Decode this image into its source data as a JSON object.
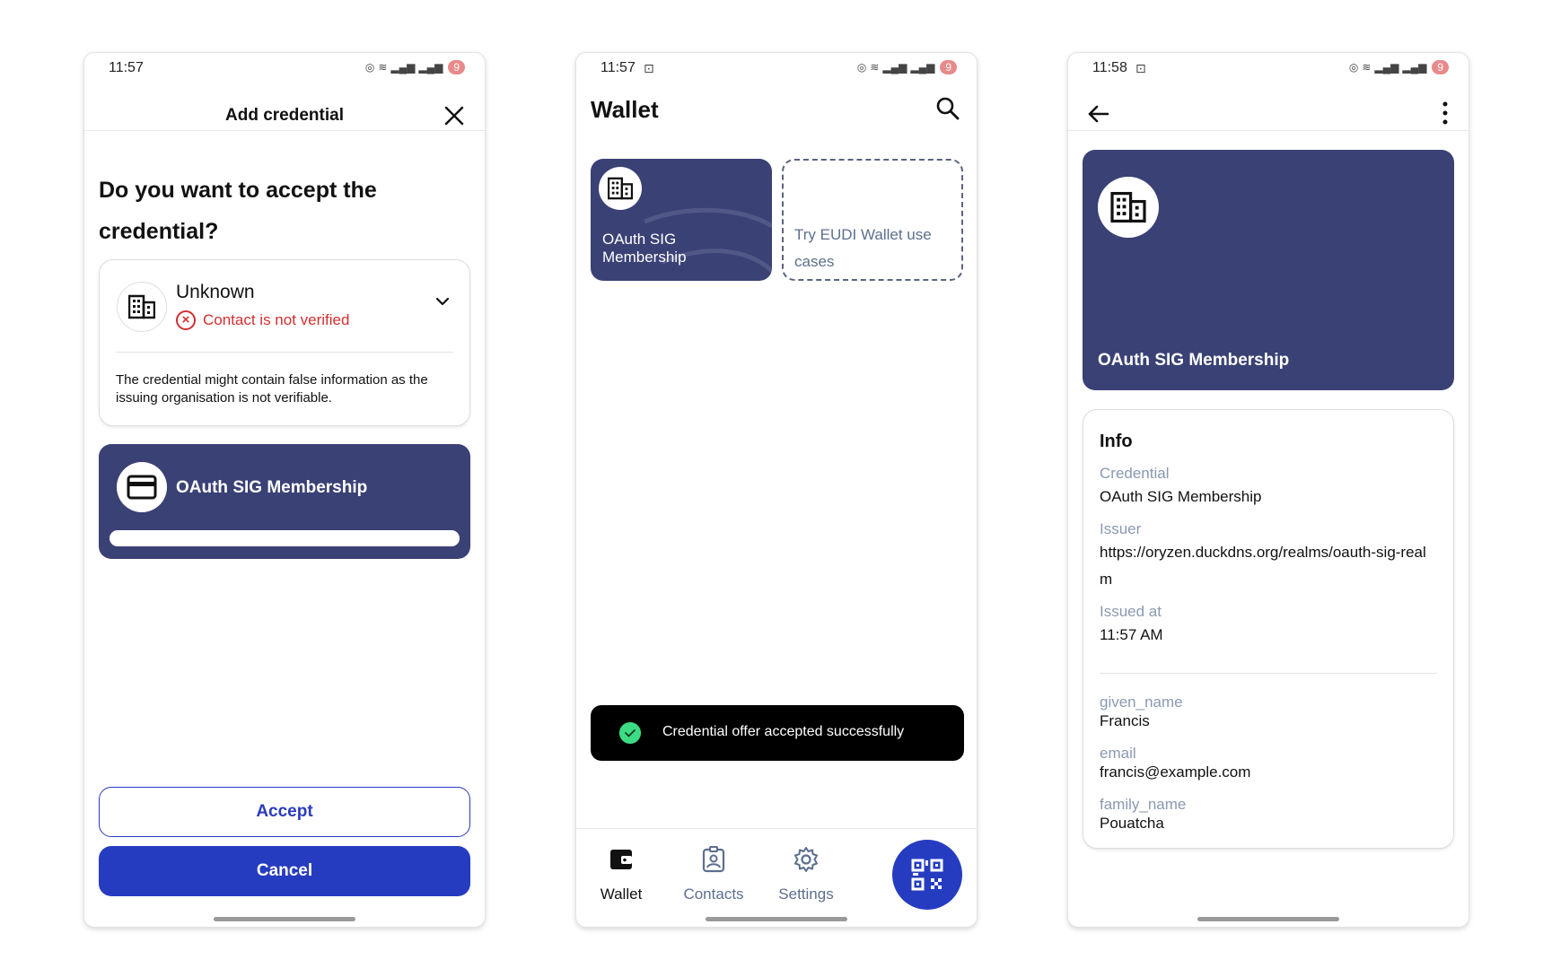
{
  "colors": {
    "card_navy": "#3a4175",
    "primary_blue": "#263cc0",
    "error_red": "#d32f2f",
    "muted_text": "#5c6f8f",
    "success_green": "#3ddc84"
  },
  "screen1": {
    "status": {
      "time": "11:57",
      "battery": "9"
    },
    "title": "Add credential",
    "question": "Do you want to accept the credential?",
    "issuer": {
      "name": "Unknown",
      "warning": "Contact is not verified",
      "description": "The credential might contain false information as the issuing organisation is not verifiable."
    },
    "credential": {
      "title": "OAuth SIG Membership"
    },
    "buttons": {
      "accept": "Accept",
      "cancel": "Cancel"
    }
  },
  "screen2": {
    "status": {
      "time": "11:57",
      "battery": "9"
    },
    "title": "Wallet",
    "card": {
      "title": "OAuth SIG Membership"
    },
    "try_card": "Try EUDI Wallet use cases",
    "toast": "Credential offer accepted successfully",
    "nav": {
      "wallet": "Wallet",
      "contacts": "Contacts",
      "settings": "Settings"
    }
  },
  "screen3": {
    "status": {
      "time": "11:58",
      "battery": "9"
    },
    "card": {
      "title": "OAuth SIG Membership"
    },
    "info": {
      "title": "Info",
      "fields": [
        {
          "label": "Credential",
          "value": "OAuth SIG Membership"
        },
        {
          "label": "Issuer",
          "value": "https://oryzen.duckdns.org/realms/oauth-sig-realm"
        },
        {
          "label": "Issued at",
          "value": "11:57 AM"
        }
      ],
      "claims": [
        {
          "label": "given_name",
          "value": "Francis"
        },
        {
          "label": "email",
          "value": "francis@example.com"
        },
        {
          "label": "family_name",
          "value": "Pouatcha"
        }
      ]
    }
  }
}
